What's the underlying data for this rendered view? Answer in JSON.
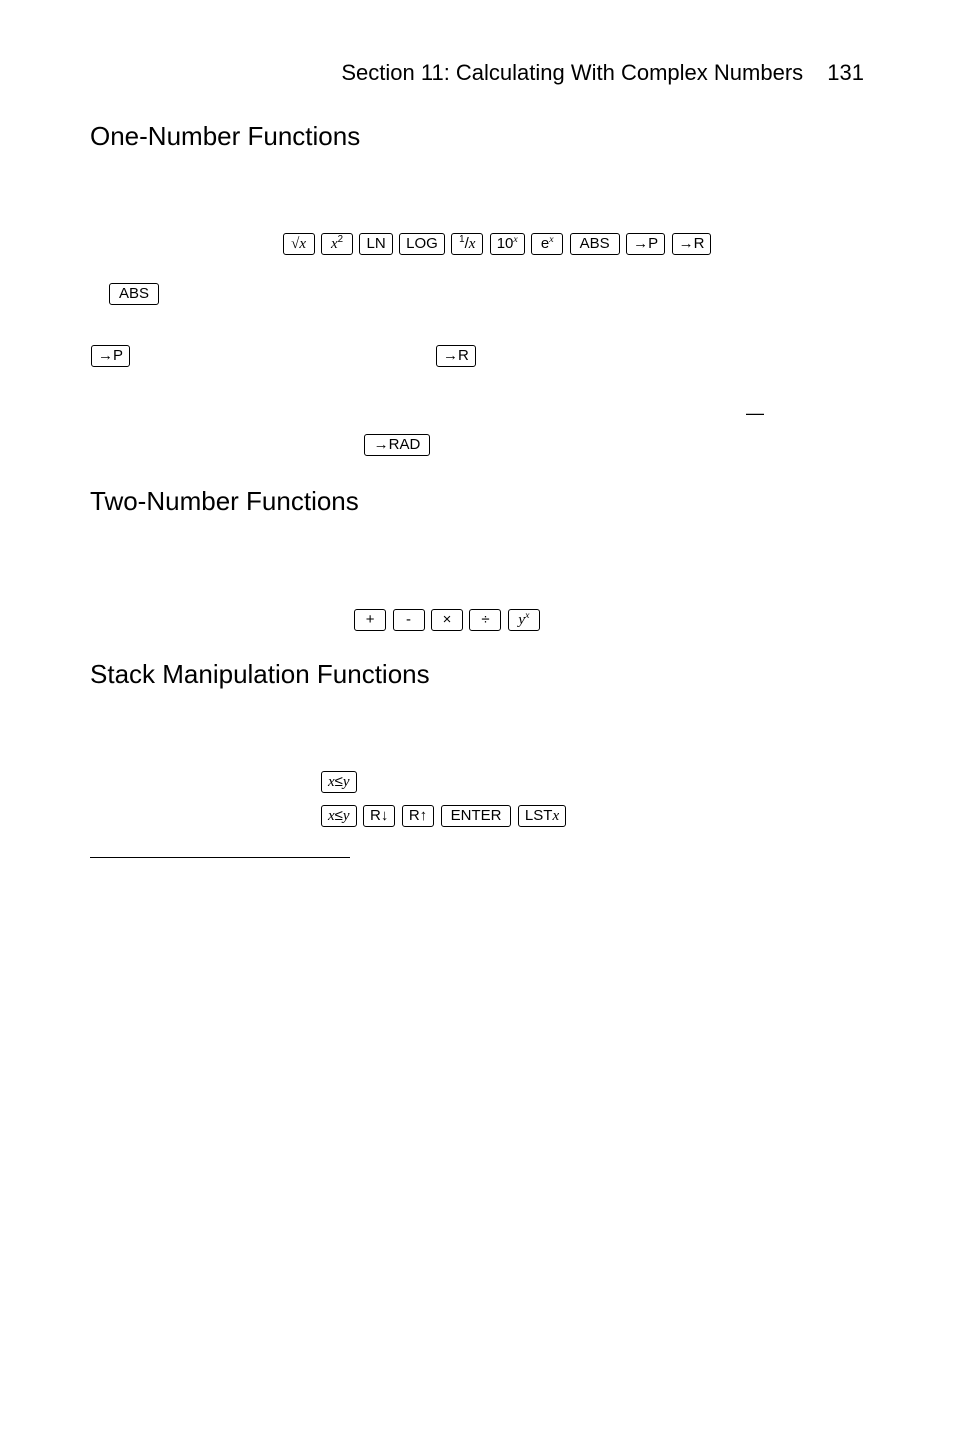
{
  "header": {
    "section_title": "Section 11: Calculating With Complex Numbers",
    "page_number": "131"
  },
  "headings": {
    "one_number": "One-Number Functions",
    "two_number": "Two-Number Functions",
    "stack_manip": "Stack Manipulation Functions"
  },
  "keys": {
    "sqrt_x": "√x",
    "x_sq": "x²",
    "ln": "LN",
    "log": "LOG",
    "recip": "1/x",
    "ten_x": "10ˣ",
    "e_x": "eˣ",
    "abs": "ABS",
    "to_p": "→P",
    "to_r": "→R",
    "to_rad": "→RAD",
    "plus": "+",
    "minus": "-",
    "times": "×",
    "divide": "÷",
    "y_x": "yˣ",
    "xy_swap": "x≤y",
    "r_down": "R↓",
    "r_up": "R↑",
    "enter": "ENTER",
    "lstx": "LSTx"
  },
  "dash": "—"
}
